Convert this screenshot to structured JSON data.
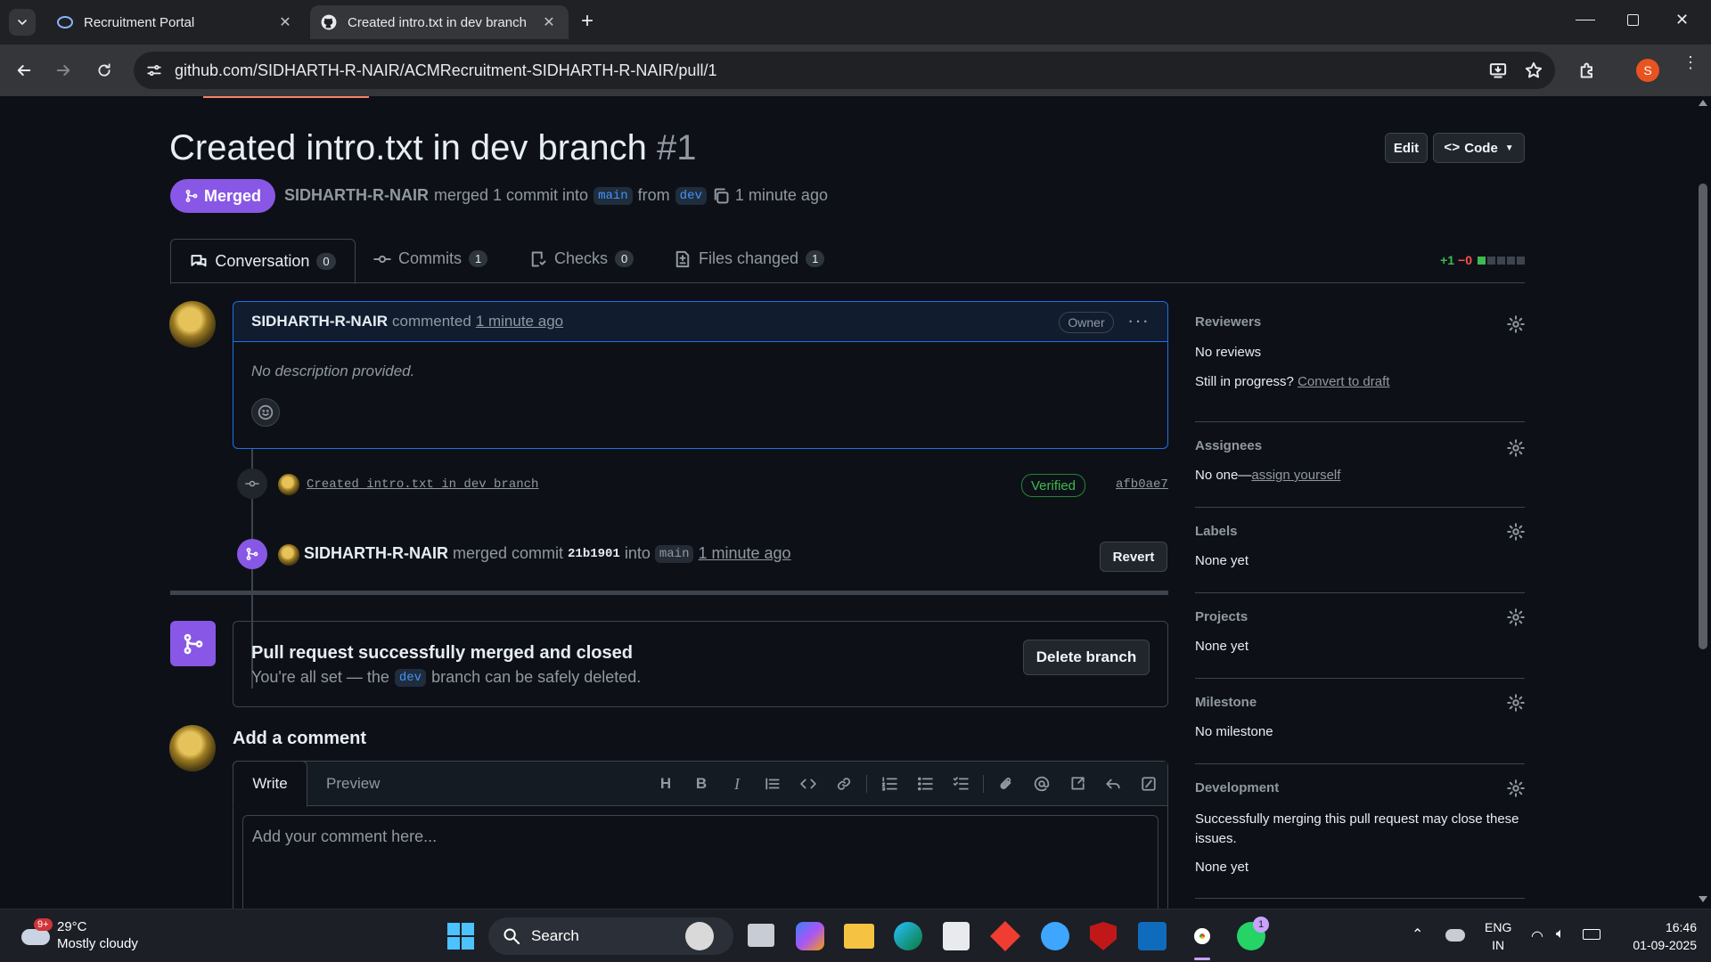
{
  "browser": {
    "tabs": [
      {
        "title": "Recruitment Portal"
      },
      {
        "title": "Created intro.txt in dev branch"
      }
    ],
    "url": "github.com/SIDHARTH-R-NAIR/ACMRecruitment-SIDHARTH-R-NAIR/pull/1",
    "profile_initial": "S"
  },
  "pr": {
    "title": "Created intro.txt in dev branch",
    "number": "#1",
    "edit_label": "Edit",
    "code_label": "Code",
    "state": "Merged",
    "author": "SIDHARTH-R-NAIR",
    "merged_text": "merged 1 commit into",
    "base_branch": "main",
    "from_text": "from",
    "head_branch": "dev",
    "time": "1 minute ago",
    "diffstat_add": "+1",
    "diffstat_del": "−0"
  },
  "tabs": [
    {
      "label": "Conversation",
      "count": "0"
    },
    {
      "label": "Commits",
      "count": "1"
    },
    {
      "label": "Checks",
      "count": "0"
    },
    {
      "label": "Files changed",
      "count": "1"
    }
  ],
  "comment": {
    "author": "SIDHARTH-R-NAIR",
    "action": "commented",
    "time": "1 minute ago",
    "badge": "Owner",
    "body": "No description provided."
  },
  "timeline": {
    "commit_message": "Created intro.txt in dev branch",
    "verified": "Verified",
    "commit_sha": "afb0ae7",
    "merge_author": "SIDHARTH-R-NAIR",
    "merge_text": "merged commit",
    "merge_sha": "21b1901",
    "into_text": "into",
    "merge_base": "main",
    "merge_time": "1 minute ago",
    "revert_label": "Revert"
  },
  "merged_box": {
    "title": "Pull request successfully merged and closed",
    "text_before": "You're all set — the",
    "branch": "dev",
    "text_after": "branch can be safely deleted.",
    "delete_label": "Delete branch"
  },
  "add_comment": {
    "heading": "Add a comment",
    "write_tab": "Write",
    "preview_tab": "Preview",
    "placeholder": "Add your comment here..."
  },
  "sidebar": {
    "reviewers": {
      "label": "Reviewers",
      "value": "No reviews",
      "progress_text": "Still in progress?",
      "convert_link": "Convert to draft"
    },
    "assignees": {
      "label": "Assignees",
      "value": "No one—",
      "link": "assign yourself"
    },
    "labels": {
      "label": "Labels",
      "value": "None yet"
    },
    "projects": {
      "label": "Projects",
      "value": "None yet"
    },
    "milestone": {
      "label": "Milestone",
      "value": "No milestone"
    },
    "development": {
      "label": "Development",
      "text": "Successfully merging this pull request may close these issues.",
      "value": "None yet"
    }
  },
  "taskbar": {
    "weather_temp": "29°C",
    "weather_desc": "Mostly cloudy",
    "weather_badge": "9+",
    "search_label": "Search",
    "lang1": "ENG",
    "lang2": "IN",
    "time": "16:46",
    "date": "01-09-2025",
    "whatsapp_badge": "1"
  },
  "colors": {
    "merged": "#8957e5",
    "link": "#4493f8",
    "success": "#3fb950",
    "danger": "#f85149"
  }
}
